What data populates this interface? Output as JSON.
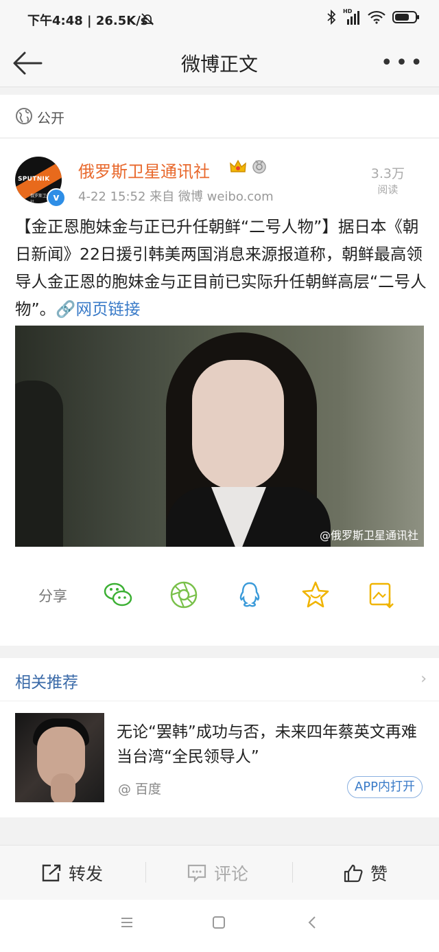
{
  "status_bar": {
    "left_text": "下午4:48 | 26.5K/s",
    "icons": [
      "mute-icon",
      "bluetooth-icon",
      "signal-icon",
      "wifi-icon",
      "battery-icon"
    ],
    "signal_label": "HD"
  },
  "nav": {
    "title": "微博正文",
    "more": "•••"
  },
  "visibility": {
    "label": "公开"
  },
  "post": {
    "author": "俄罗斯卫星通讯社",
    "avatar_text": "SPUTNIK",
    "avatar_subtext": "俄罗斯卫星通讯社",
    "verified_mark": "v",
    "meta": "4-22 15:52   来自 微博 weibo.com",
    "reads_count": "3.3万",
    "reads_label": "阅读",
    "text": "【金正恩胞妹金与正已升任朝鲜“二号人物”】据日本《朝日新闻》22日援引韩美两国消息来源报道称，朝鲜最高领导人金正恩的胞妹金与正目前已实际升任朝鲜高层“二号人物”。",
    "link_label": "网页链接",
    "link_icon": "🔗",
    "image_watermark": "@俄罗斯卫星通讯社",
    "share_label": "分享"
  },
  "related": {
    "title": "相关推荐",
    "chevron": "›",
    "headline": "无论“罢韩”成功与否，未来四年蔡英文再难当台湾“全民领导人”",
    "source": "@ 百度",
    "open_app": "APP内打开"
  },
  "actions": {
    "repost": "转发",
    "comment": "评论",
    "like": "赞"
  },
  "colors": {
    "author": "#e8682c",
    "link": "#3a7bc8",
    "wechat": "#3cb034",
    "moments": "#79c04a",
    "qq": "#3a9ad9",
    "favorite": "#f0b400",
    "save": "#f0b400"
  }
}
